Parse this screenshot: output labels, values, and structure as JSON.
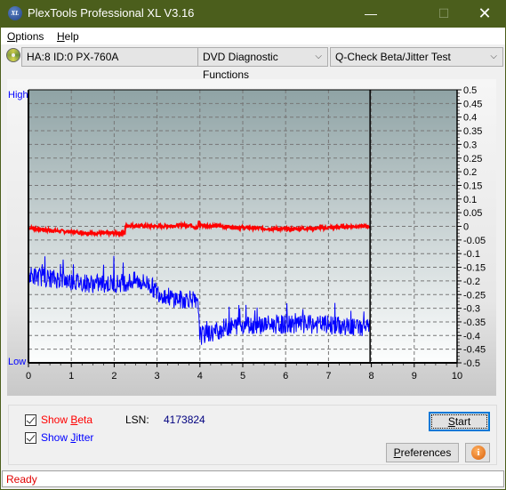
{
  "window": {
    "title": "PlexTools Professional XL V3.16",
    "icon": "xl-app-icon",
    "icon_text": "XL",
    "controls": {
      "minimize": "—",
      "maximize": "☐",
      "close": "✕"
    }
  },
  "menu": {
    "items": [
      {
        "label": "Options",
        "accel": "O",
        "rest": "ptions"
      },
      {
        "label": "Help",
        "accel": "H",
        "rest": "elp"
      }
    ]
  },
  "toolbar": {
    "drive_select": "HA:8 ID:0  PX-760A",
    "function_select": "DVD Diagnostic Functions",
    "test_select": "Q-Check Beta/Jitter Test",
    "chevron": "⌵"
  },
  "chart_data": {
    "type": "line",
    "title": "",
    "xlabel": "",
    "ylabel": "",
    "left_axis_labels": {
      "top": "High",
      "bottom": "Low"
    },
    "xlim": [
      0,
      10
    ],
    "ylim": [
      -0.5,
      0.5
    ],
    "x_ticks": [
      0,
      1,
      2,
      3,
      4,
      5,
      6,
      7,
      8,
      9,
      10
    ],
    "y_ticks": [
      0.5,
      0.45,
      0.4,
      0.35,
      0.3,
      0.25,
      0.2,
      0.15,
      0.1,
      0.05,
      0,
      -0.05,
      -0.1,
      -0.15,
      -0.2,
      -0.25,
      -0.3,
      -0.35,
      -0.4,
      -0.45,
      -0.5
    ],
    "y_tick_labels": [
      "0.5",
      "0.45",
      "0.4",
      "0.35",
      "0.3",
      "0.25",
      "0.2",
      "0.15",
      "0.1",
      "0.05",
      "0",
      "-0.05",
      "-0.1",
      "-0.15",
      "-0.2",
      "-0.25",
      "-0.3",
      "-0.35",
      "-0.4",
      "-0.45",
      "-0.5"
    ],
    "grid": true,
    "end_marker_x": 7.97,
    "series": [
      {
        "name": "Beta",
        "color": "#ff0000",
        "x": [
          0,
          0.5,
          1.0,
          1.5,
          2.0,
          2.25,
          2.26,
          2.5,
          3.0,
          3.5,
          3.8,
          3.95,
          3.97,
          4.0,
          4.5,
          5.0,
          5.5,
          6.0,
          6.5,
          7.0,
          7.5,
          7.97
        ],
        "values": [
          -0.005,
          -0.015,
          -0.02,
          -0.025,
          -0.025,
          -0.025,
          0.003,
          0.002,
          0.0,
          0.003,
          0.005,
          -0.01,
          0.02,
          0.005,
          0.0,
          -0.005,
          -0.008,
          -0.01,
          -0.008,
          -0.005,
          0.0,
          0.0
        ],
        "noise": 0.006
      },
      {
        "name": "Jitter",
        "color": "#0000ff",
        "x": [
          0,
          0.5,
          1.0,
          1.5,
          2.0,
          2.5,
          2.8,
          3.0,
          3.3,
          3.6,
          3.8,
          3.97,
          4.0,
          4.3,
          4.6,
          5.0,
          5.5,
          6.0,
          6.5,
          7.0,
          7.5,
          7.97
        ],
        "values": [
          -0.18,
          -0.19,
          -0.2,
          -0.21,
          -0.21,
          -0.2,
          -0.21,
          -0.24,
          -0.26,
          -0.27,
          -0.26,
          -0.3,
          -0.4,
          -0.39,
          -0.37,
          -0.36,
          -0.36,
          -0.36,
          -0.36,
          -0.36,
          -0.37,
          -0.37
        ],
        "noise": 0.035
      }
    ]
  },
  "controls": {
    "show_beta": {
      "label_pre": "Show ",
      "accel": "B",
      "label_post": "eta",
      "checked": true,
      "color": "#ff0000"
    },
    "show_jitter": {
      "label_pre": "Show ",
      "accel": "J",
      "label_post": "itter",
      "checked": true,
      "color": "#0000ff"
    },
    "lsn_label": "LSN:",
    "lsn_value": "4173824",
    "start_button": {
      "accel": "S",
      "rest": "tart"
    },
    "preferences_button": {
      "accel": "P",
      "rest": "references"
    },
    "info_button": "i"
  },
  "status": {
    "text": "Ready"
  }
}
